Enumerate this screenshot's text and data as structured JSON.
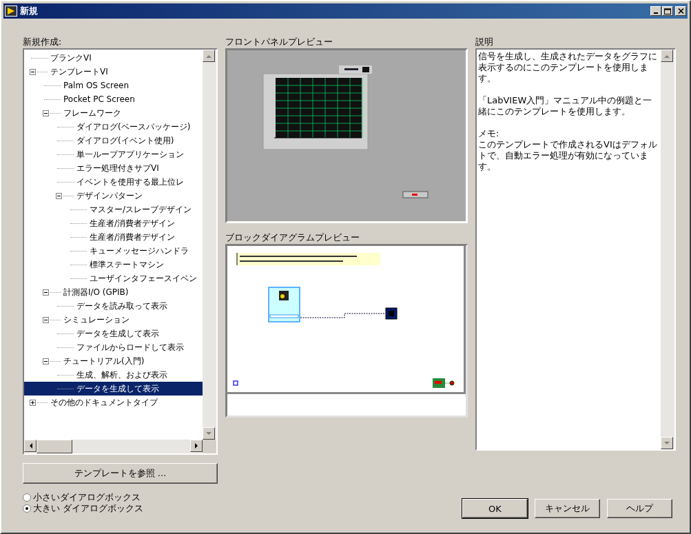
{
  "window": {
    "title": "新規"
  },
  "new_list": {
    "label": "新規作成:",
    "items": [
      {
        "label": "ブランクVI",
        "selected": false
      },
      {
        "label": "テンプレートVI",
        "selected": false,
        "expanded": true,
        "children": [
          {
            "label": "Palm OS Screen",
            "selected": false
          },
          {
            "label": "Pocket PC Screen",
            "selected": false
          },
          {
            "label": "フレームワーク",
            "selected": false,
            "expanded": true,
            "children": [
              {
                "label": "ダイアログ(ベースパッケージ)",
                "selected": false
              },
              {
                "label": "ダイアログ(イベント使用)",
                "selected": false
              },
              {
                "label": "単一ループアプリケーション",
                "selected": false
              },
              {
                "label": "エラー処理付きサブVI",
                "selected": false
              },
              {
                "label": "イベントを使用する最上位レ",
                "selected": false
              },
              {
                "label": "デザインパターン",
                "selected": false,
                "expanded": true,
                "children": [
                  {
                    "label": "マスター/スレーブデザイン",
                    "selected": false
                  },
                  {
                    "label": "生産者/消費者デザイン",
                    "selected": false
                  },
                  {
                    "label": "生産者/消費者デザイン",
                    "selected": false
                  },
                  {
                    "label": "キューメッセージハンドラ",
                    "selected": false
                  },
                  {
                    "label": "標準ステートマシン",
                    "selected": false
                  },
                  {
                    "label": "ユーザインタフェースイベン",
                    "selected": false
                  }
                ]
              }
            ]
          },
          {
            "label": "計測器I/O (GPIB)",
            "selected": false,
            "expanded": true,
            "children": [
              {
                "label": "データを読み取って表示",
                "selected": false
              }
            ]
          },
          {
            "label": "シミュレーション",
            "selected": false,
            "expanded": true,
            "children": [
              {
                "label": "データを生成して表示",
                "selected": false
              },
              {
                "label": "ファイルからロードして表示",
                "selected": false
              }
            ]
          },
          {
            "label": "チュートリアル(入門)",
            "selected": false,
            "expanded": true,
            "children": [
              {
                "label": "生成、解析、および表示",
                "selected": false
              },
              {
                "label": "データを生成して表示",
                "selected": true
              }
            ]
          }
        ]
      },
      {
        "label": "その他のドキュメントタイプ",
        "selected": false,
        "expanded": false
      }
    ]
  },
  "browse_button": "テンプレートを参照 ...",
  "dialog_size": [
    {
      "label": "小さいダイアログボックス",
      "selected": false
    },
    {
      "label": "大きい ダイアログボックス",
      "selected": true
    }
  ],
  "front_panel_preview": {
    "label": "フロントパネルプレビュー"
  },
  "block_diagram_preview": {
    "label": "ブロックダイアグラムプレビュー"
  },
  "description": {
    "label": "説明",
    "paragraphs": [
      [
        "信号を生成し、生成されたデータをグラフに表示するのにこのテンプレートを使用します。"
      ],
      [
        "「LabVIEW入門」マニュアル中の例題と一緒にこのテンプレートを使用します。"
      ],
      [
        "メモ:",
        "このテンプレートで作成されるVIはデフォルトで、自動エラー処理が有効になっています。"
      ]
    ]
  },
  "buttons": [
    {
      "label": "OK",
      "default": true
    },
    {
      "label": "キャンセル",
      "default": false
    },
    {
      "label": "ヘルプ",
      "default": false
    }
  ]
}
